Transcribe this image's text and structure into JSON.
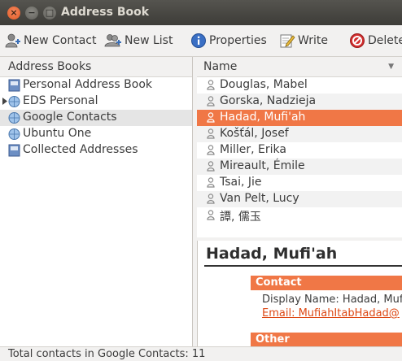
{
  "window": {
    "title": "Address Book"
  },
  "toolbar": {
    "new_contact": "New Contact",
    "new_list": "New List",
    "properties": "Properties",
    "write": "Write",
    "delete": "Delete"
  },
  "address_books": {
    "header": "Address Books",
    "items": [
      {
        "label": "Personal Address Book",
        "icon": "address-book-icon"
      },
      {
        "label": "EDS Personal",
        "icon": "globe-icon",
        "expandable": true
      },
      {
        "label": "Google Contacts",
        "icon": "globe-icon",
        "selected": true
      },
      {
        "label": "Ubuntu One",
        "icon": "globe-icon"
      },
      {
        "label": "Collected Addresses",
        "icon": "address-book-icon"
      }
    ]
  },
  "contacts": {
    "column_header": "Name",
    "rows": [
      {
        "name": "Douglas, Mabel"
      },
      {
        "name": "Gorska, Nadzieja"
      },
      {
        "name": "Hadad, Mufi'ah",
        "selected": true
      },
      {
        "name": "Košťál, Josef"
      },
      {
        "name": "Miller, Erika"
      },
      {
        "name": "Mireault, Émile"
      },
      {
        "name": "Tsai, Jie"
      },
      {
        "name": "Van Pelt, Lucy"
      },
      {
        "name": "譚, 儒玉"
      }
    ]
  },
  "card": {
    "name": "Hadad, Mufi'ah",
    "contact_header": "Contact",
    "display_name": "Display Name: Hadad, Mufi'ah",
    "email": "Email: MufiahItabHadad@",
    "other_header": "Other"
  },
  "status": {
    "text": "Total contacts in Google Contacts: 11"
  },
  "colors": {
    "accent": "#f07746",
    "link": "#dd4814",
    "titlebar": "#3d3c38"
  }
}
